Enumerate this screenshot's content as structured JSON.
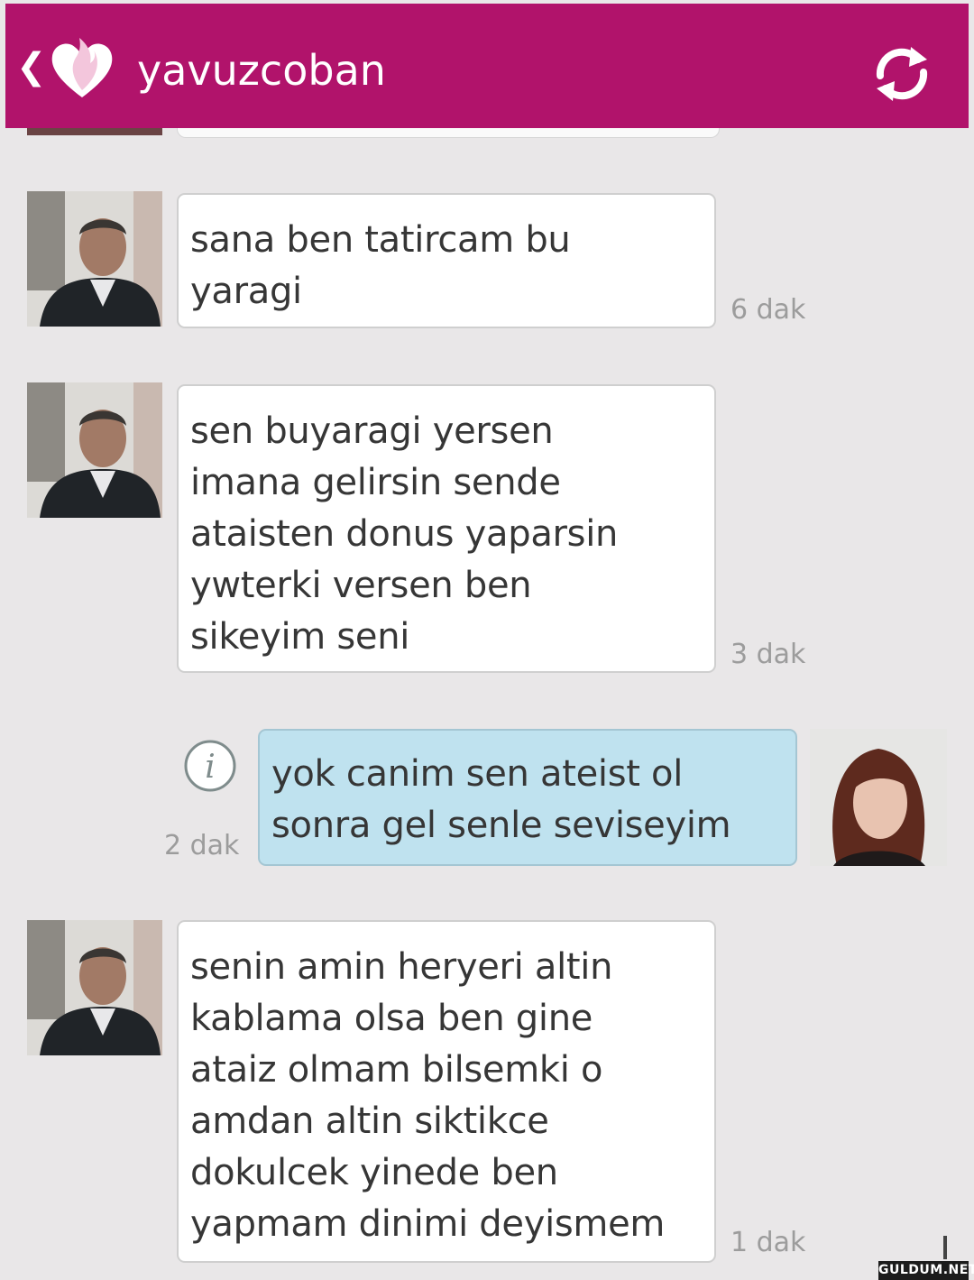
{
  "header": {
    "back_icon": "chevron-left-icon",
    "logo_icon": "heart-flame-icon",
    "username": "yavuzcoban",
    "refresh_icon": "refresh-icon",
    "bg_color": "#b1136b"
  },
  "messages": [
    {
      "from": "other",
      "text": "sana ben tatircam bu\nyaragi",
      "time": "6 dak"
    },
    {
      "from": "other",
      "text": "sen buyaragi yersen\nimana gelirsin sende\nataisten donus yaparsin\nywterki versen ben\nsikeyim seni",
      "time": "3 dak"
    },
    {
      "from": "me",
      "text": "yok canim sen ateist ol\nsonra gel senle seviseyim",
      "time": "2 dak",
      "status_icon": "info-icon"
    },
    {
      "from": "other",
      "text": "senin amin heryeri altin\nkablama olsa ben gine\nataiz olmam bilsemki o\namdan altin siktikce\ndokulcek yinede ben\nyapmam dinimi deyismem",
      "time": "1 dak"
    }
  ],
  "watermark": "GULDUM.NET",
  "colors": {
    "my_bubble": "#bfe2ef",
    "other_bubble": "#ffffff",
    "background": "#e9e7e8"
  }
}
